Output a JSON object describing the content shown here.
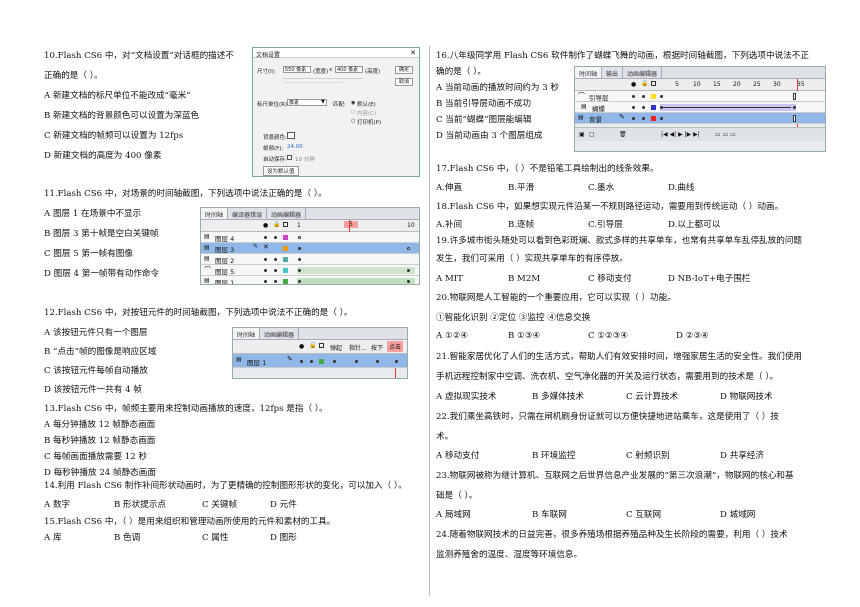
{
  "left": {
    "q10": {
      "stem1": "10.Flash CS6 中，对“文档设置”对话框的描述不",
      "stem2": "正确的是（    ）。",
      "a": "A 新建文档的标尺单位不能改成“毫米”",
      "b": "B 新建文档的背景颜色可以设置为深蓝色",
      "c": "C 新建文档的帧频可以设置为 12fps",
      "d": "D 新建文档的高度为 400 像素"
    },
    "dialog": {
      "title": "文档设置",
      "size_label": "尺寸(I):",
      "width_value": "550 像素",
      "width_label": "(宽度)",
      "x_sep": "x",
      "height_value": "400 像素",
      "height_label": "(高度)",
      "ok": "确定",
      "cancel": "取消",
      "ruler_label": "标尺单位(R):",
      "ruler_value": "像素",
      "match_label": "匹配:",
      "opt1": "默认(E)",
      "opt2": "内容(C)",
      "opt3": "打印机(P)",
      "bg_label": "背景颜色:",
      "fps_label": "帧频(F):",
      "fps_value": "24.00",
      "autosave_label": "自动保存:",
      "autosave_value": "10 分钟",
      "set_default": "设为默认值"
    },
    "q11": {
      "stem": "11.Flash CS6 中，对场景的时间轴截图，下列选项中说法正确的是（    ）。",
      "a": "A 图层 1 在场景中不显示",
      "b": "B 图层 3 第十帧是空白关键帧",
      "c": "C 图层 5 第一帧有图像",
      "d": "D 图层 4 第一帧带有动作命令"
    },
    "tl11": {
      "tab1": "时间轴",
      "tab2": "编译器错误",
      "tab3": "动画编辑器",
      "frame1": "1",
      "frame5": "5",
      "frame10": "10",
      "layers": [
        "图层 4",
        "图层 3",
        "图层 2",
        "图层 5",
        "图层 1"
      ]
    },
    "q12": {
      "stem": "12.Flash CS6 中，对按钮元件的时间轴截图，下列选项中说法不正确的是（    ）。",
      "a": "A 该按钮元件只有一个图层",
      "b": "B “点击”帧的图像是响应区域",
      "c": "C 该按钮元件每帧自动播放",
      "d": "D 该按钮元件一共有 4 帧"
    },
    "tl12": {
      "tab1": "时间轴",
      "tab2": "动画编辑器",
      "f_up": "弹起",
      "f_over": "指针...",
      "f_down": "按下",
      "f_hit": "点击",
      "layer": "图层 1"
    },
    "q13": {
      "stem": "13.Flash CS6 中，帧频主要用来控制动画播放的速度，12fps 是指（    ）。",
      "a": "A 每分钟播放 12 帧静态画面",
      "b": "B 每秒钟播放 12 帧静态画面",
      "c": "C 每帧画面播放需要 12 秒",
      "d": "D 每秒钟播放 24 帧静态画面"
    },
    "q14": {
      "stem": "14.利用 Flash CS6 制作补间形状动画时，为了更精确的控制图形形状的变化，可以加入（    ）。",
      "a": "A 数字",
      "b": "B 形状提示点",
      "c": "C 关键帧",
      "d": "D 元件"
    },
    "q15": {
      "stem": "15.Flash CS6 中，（     ）是用来组织和管理动画所使用的元件和素材的工具。",
      "a": "A 库",
      "b": "B 色调",
      "c": "C 属性",
      "d": "D 图形"
    }
  },
  "right": {
    "q16": {
      "stem1": "16.八年级同学用 Flash CS6 软件制作了蝴蝶飞舞的动画，根据时间轴截图，下列选项中说法不正",
      "stem2": "确的是（    ）。",
      "a": "A 当前动画的播放时间约为 3 秒",
      "b": "B 当前引导层动画不成功",
      "c": "C 当前“蝴蝶”图层能编辑",
      "d": "D 当前动画由 3 个图层组成"
    },
    "tl16": {
      "tab1": "时间轴",
      "tab2": "输出",
      "tab3": "动画编辑器",
      "ticks": [
        "5",
        "10",
        "15",
        "20",
        "25",
        "30",
        "35"
      ],
      "layers": [
        "引导层",
        "蝴蝶",
        "背景"
      ]
    },
    "q17": {
      "stem": "17.Flash CS6 中，（     ）不是铅笔工具绘制出的线条效果。",
      "a": "A.伸直",
      "b": "B.平滑",
      "c": "C.墨水",
      "d": "D.曲线"
    },
    "q18": {
      "stem": "18.Flash CS6 中，如果想实现元件沿某一不规则路径运动，需要用到传统运动（     ）动画。",
      "a": "A.补间",
      "b": "B.逐帧",
      "c": "C.引导层",
      "d": "D.以上都可以"
    },
    "q19": {
      "stem1": "19.许多城市街头随处可以看到色彩斑斓、款式多样的共享单车，也常有共享单车乱停乱放的问题",
      "stem2": "发生，我们可采用（     ）实现共享单车的有序停放。",
      "a": "A MIT",
      "b": "B M2M",
      "c": "C 移动支付",
      "d": "D NB-IoT+电子围栏"
    },
    "q20": {
      "stem": "20.物联网是人工智能的一个重要应用，它可以实现（     ）功能。",
      "items": "①智能化识别      ②定位      ③监控      ④信息交换",
      "a": "A ①②④",
      "b": "B ①③④",
      "c": "C ①②③④",
      "d": "D ②③④"
    },
    "q21": {
      "stem1": "21.智能家居优化了人们的生活方式，帮助人们有效安排时间，增强家居生活的安全性。我们使用",
      "stem2": "手机远程控制家中空调、洗衣机、空气净化器的开关及运行状态，需要用到的技术是（     ）。",
      "a": "A 虚拟现实技术",
      "b": "B 多媒体技术",
      "c": "C 云计算技术",
      "d": "D 物联网技术"
    },
    "q22": {
      "stem1": "22.我们乘坐高铁时，只需在闸机刷身份证就可以方便快捷地进站乘车，这是使用了（     ）技",
      "stem2": "术。",
      "a": "A 移动支付",
      "b": "B 环境监控",
      "c": "C 射频识别",
      "d": "D 共享经济"
    },
    "q23": {
      "stem1": "23.物联网被称为继计算机、互联网之后世界信息产业发展的“第三次浪潮”，物联网的核心和基",
      "stem2": "础是（     ）。",
      "a": "A 局域网",
      "b": "B 车联网",
      "c": "C 互联网",
      "d": "D 城域网"
    },
    "q24": {
      "stem1": "24.随着物联网技术的日益完善，很多养殖场根据养殖品种及生长阶段的需要，利用（     ）技术",
      "stem2": "监测养殖舍的温度、湿度等环境信息。"
    }
  }
}
